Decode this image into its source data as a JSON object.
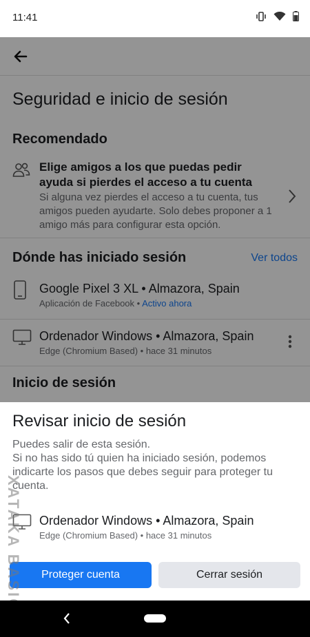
{
  "status_bar": {
    "time": "11:41"
  },
  "page": {
    "title": "Seguridad e inicio de sesión"
  },
  "recommended": {
    "heading": "Recomendado",
    "title": "Elige amigos a los que puedas pedir ayuda si pierdes el acceso a tu cuenta",
    "description": "Si alguna vez pierdes el acceso a tu cuenta, tus amigos pueden ayudarte. Solo debes proponer a 1 amigo más para configurar esta opción."
  },
  "where_logged_in": {
    "heading": "Dónde has iniciado sesión",
    "see_all": "Ver todos",
    "devices": [
      {
        "name": "Google Pixel 3 XL • Almazora, Spain",
        "app": "Aplicación de Facebook",
        "separator": " • ",
        "status": "Activo ahora",
        "icon": "phone-icon"
      },
      {
        "name": "Ordenador Windows • Almazora, Spain",
        "meta": "Edge (Chromium Based) • hace 31 minutos",
        "icon": "desktop-icon"
      }
    ]
  },
  "login_section": {
    "heading": "Inicio de sesión"
  },
  "sheet": {
    "title": "Revisar inicio de sesión",
    "body": "Puedes salir de esta sesión.\nSi no has sido tú quien ha iniciado sesión, podemos indicarte los pasos que debes seguir para proteger tu cuenta.",
    "device_name": "Ordenador Windows • Almazora, Spain",
    "device_meta": "Edge (Chromium Based) • hace 31 minutos",
    "primary_button": "Proteger cuenta",
    "secondary_button": "Cerrar sesión"
  },
  "watermark": "XATAKA BASICS",
  "colors": {
    "accent": "#1877f2",
    "text": "#1c1e21",
    "secondary_text": "#65676b",
    "button_gray": "#e4e6eb"
  }
}
